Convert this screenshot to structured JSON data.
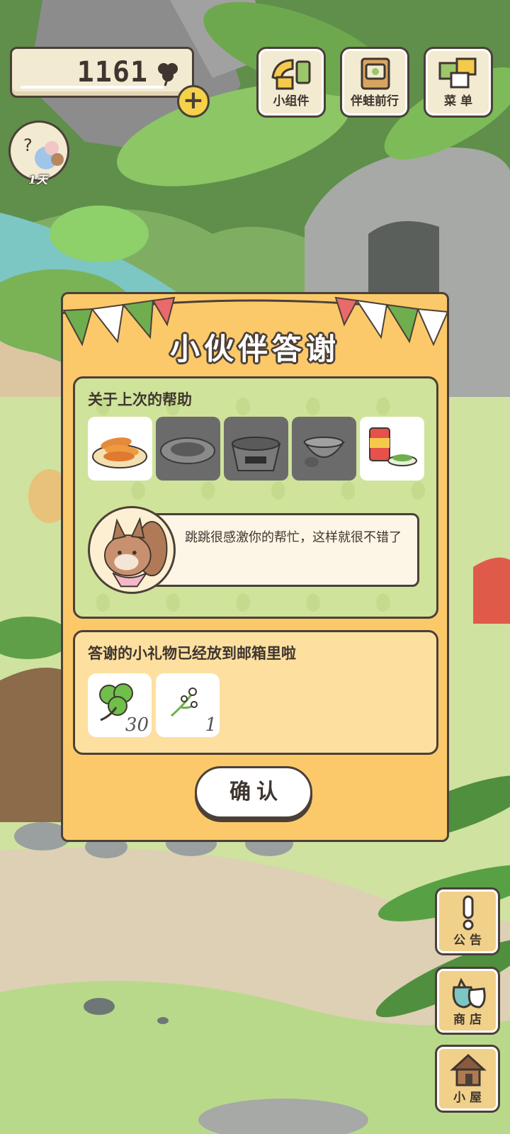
{
  "hud": {
    "clover_count": "1161",
    "days_label": "1天"
  },
  "top_buttons": [
    {
      "label": "小组件",
      "icon": "widget-icon"
    },
    {
      "label": "伴蛙前行",
      "icon": "travel-book-icon"
    },
    {
      "label": "菜 单",
      "icon": "menu-cards-icon"
    }
  ],
  "side_buttons": [
    {
      "label": "公 告",
      "icon": "exclamation-icon"
    },
    {
      "label": "商 店",
      "icon": "shop-bag-icon"
    },
    {
      "label": "小 屋",
      "icon": "house-icon"
    }
  ],
  "dialog": {
    "title": "小伙伴答谢",
    "help_section_title": "关于上次的帮助",
    "foods": [
      {
        "icon": "fried-shrimp-plate-icon",
        "style": "light"
      },
      {
        "icon": "stir-fry-plate-icon",
        "style": "dark"
      },
      {
        "icon": "noodle-bowl-icon",
        "style": "dark"
      },
      {
        "icon": "soup-bowl-icon",
        "style": "dark"
      },
      {
        "icon": "canned-food-icon",
        "style": "light"
      }
    ],
    "message": "跳跳很感激你的帮忙，这样就很不错了",
    "gift_section_title": "答谢的小礼物已经放到邮箱里啦",
    "gifts": [
      {
        "icon": "clover-icon",
        "quantity": "30"
      },
      {
        "icon": "flower-sprig-icon",
        "quantity": "1"
      }
    ],
    "confirm_label": "确认"
  },
  "colors": {
    "modal_bg": "#fcc96a",
    "help_panel_bg": "#cfe39b",
    "gift_panel_bg": "#fde0a0",
    "outline": "#4b4038"
  }
}
